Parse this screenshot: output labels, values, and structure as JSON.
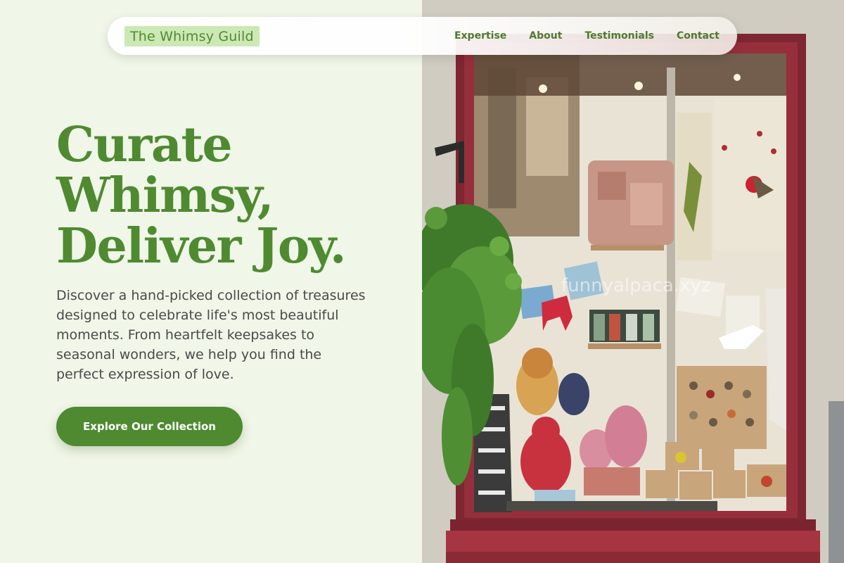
{
  "brand": {
    "name": "The Whimsy Guild"
  },
  "nav": {
    "links": [
      "Expertise",
      "About",
      "Testimonials",
      "Contact"
    ]
  },
  "hero": {
    "title_lines": [
      "Curate",
      "Whimsy,",
      "Deliver Joy."
    ],
    "description": "Discover a hand-picked collection of treasures designed to celebrate life's most beautiful moments. From heartfelt keepsakes to seasonal wonders, we help you find the perfect expression of love.",
    "cta_label": "Explore Our Collection"
  },
  "photo": {
    "watermark": "funnyalpaca.xyz"
  },
  "colors": {
    "accent": "#4f8a31",
    "brand_bg": "#cce8b4",
    "page_bg": "#f0f6e8",
    "window_frame": "#8a2a35"
  }
}
